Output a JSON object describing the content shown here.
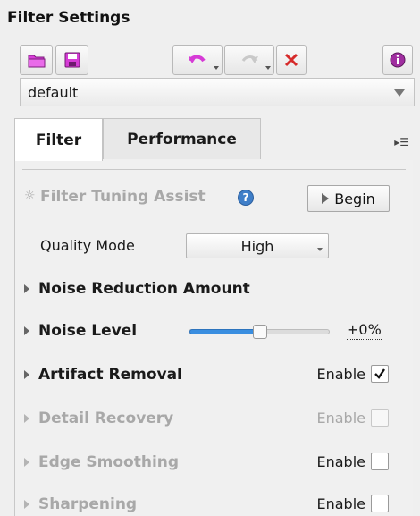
{
  "window": {
    "title": "Filter Settings"
  },
  "toolbar": {
    "open_icon": "folder-icon",
    "save_icon": "save-icon",
    "undo_icon": "undo-icon",
    "redo_icon": "redo-icon",
    "reset_icon": "close-x-icon",
    "info_icon": "info-icon"
  },
  "preset": {
    "value": "default"
  },
  "tabs": [
    {
      "label": "Filter",
      "active": true
    },
    {
      "label": "Performance",
      "active": false
    }
  ],
  "tab_menu_glyph": "▸☰",
  "assist": {
    "label": "Filter Tuning Assist",
    "help_glyph": "?",
    "button_label": "Begin"
  },
  "quality": {
    "label": "Quality Mode",
    "value": "High"
  },
  "sections": {
    "noise_reduction": {
      "label": "Noise Reduction Amount"
    },
    "noise_level": {
      "label": "Noise Level",
      "value_text": "+0%",
      "slider_fraction": 0.5
    },
    "artifact_removal": {
      "label": "Artifact Removal",
      "enable_label": "Enable",
      "checked": true,
      "disabled": false
    },
    "detail_recovery": {
      "label": "Detail Recovery",
      "enable_label": "Enable",
      "checked": false,
      "disabled": true
    },
    "edge_smoothing": {
      "label": "Edge Smoothing",
      "enable_label": "Enable",
      "checked": false,
      "disabled": true
    },
    "sharpening": {
      "label": "Sharpening",
      "enable_label": "Enable",
      "checked": false,
      "disabled": true
    }
  },
  "colors": {
    "accent": "#3a8ee0",
    "undo": "#d63bd6",
    "close": "#d62a2a"
  }
}
